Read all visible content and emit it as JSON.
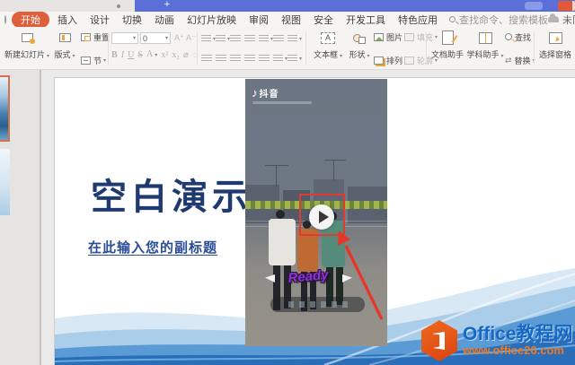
{
  "tab_bar": {
    "new_tab": "+"
  },
  "menu": {
    "items": [
      "开始",
      "插入",
      "设计",
      "切换",
      "动画",
      "幻灯片放映",
      "审阅",
      "视图",
      "安全",
      "开发工具",
      "特色应用"
    ],
    "active_item": "开始",
    "search_placeholder": "查找命令、搜索模板",
    "sync_status": "未同步"
  },
  "toolbar": {
    "new_slide": "新建幻灯片",
    "layout": "版式",
    "reset": "重置",
    "section": "节",
    "font_size_value": "0",
    "bold": "B",
    "italic": "I",
    "underline": "U",
    "strike": "S",
    "font_color": "A",
    "superscript": "x²",
    "subscript": "x₂",
    "text_box": "文本框",
    "shapes": "形状",
    "picture": "图片",
    "arrange": "排列",
    "fill": "填充",
    "outline": "轮廓",
    "doc_assistant": "文档助手",
    "subject_assistant": "学科助手",
    "find": "查找",
    "replace": "替换",
    "selection_pane": "选择窗格"
  },
  "slide": {
    "title": "空白演示",
    "subtitle": "在此输入您的副标题"
  },
  "video": {
    "platform": "抖音",
    "music_note": "♪",
    "sticker_text": "Ready"
  },
  "watermark": {
    "site_name": "Office教程网",
    "site_url": "www.office26.com"
  },
  "colors": {
    "accent_orange": "#dd5f3c",
    "tab_blue": "#5b6fd8",
    "title_navy": "#1e3a70",
    "annotation_red": "#e03b30",
    "watermark_blue": "#1668c7",
    "watermark_orange": "#f07820"
  }
}
